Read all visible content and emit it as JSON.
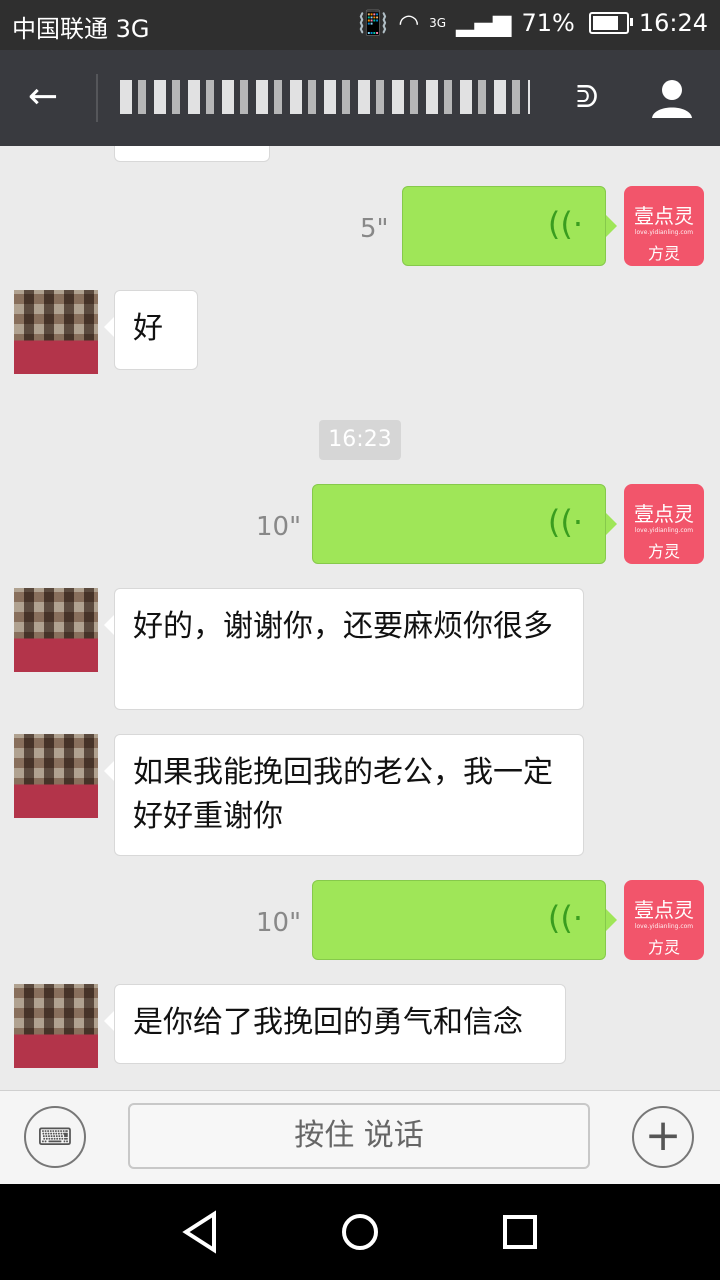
{
  "status_bar": {
    "carrier": "中国联通 3G",
    "network": "3G",
    "battery": "71%",
    "battery_level": 0.71,
    "time": "16:24"
  },
  "header": {
    "back_icon": "arrow-left-icon",
    "ear_icon": "ear-icon",
    "profile_icon": "person-icon"
  },
  "messages": [
    {
      "type": "voice_out",
      "duration": "5\""
    },
    {
      "type": "text_in",
      "text": "好"
    },
    {
      "type": "timestamp",
      "text": "16:23"
    },
    {
      "type": "voice_out",
      "duration": "10\""
    },
    {
      "type": "text_in",
      "text": "好的，谢谢你，还要麻烦你很多"
    },
    {
      "type": "text_in",
      "text": "如果我能挽回我的老公，我一定好好重谢你"
    },
    {
      "type": "voice_out",
      "duration": "10\""
    },
    {
      "type": "text_in",
      "text": "是你给了我挽回的勇气和信念"
    }
  ],
  "own_avatar": {
    "line1": "壹点灵",
    "line2": "love.yidianling.com",
    "line3": "方灵"
  },
  "input_bar": {
    "hold_to_talk": "按住 说话",
    "keyboard_icon": "keyboard-icon",
    "plus_icon": "plus-icon"
  },
  "nav_bar": {
    "back_icon": "triangle-back-icon",
    "home_icon": "circle-home-icon",
    "recent_icon": "square-recent-icon"
  }
}
